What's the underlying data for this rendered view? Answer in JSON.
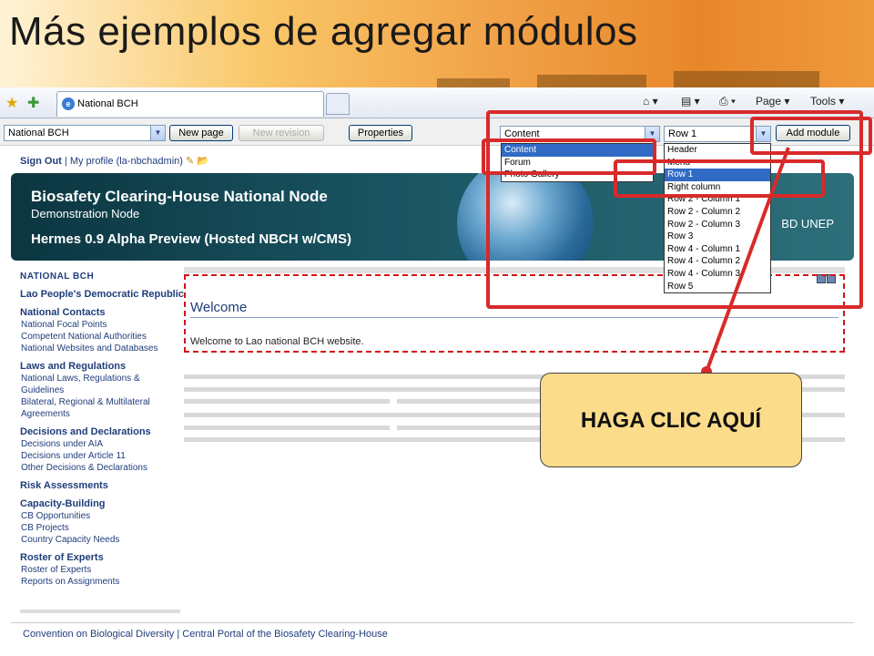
{
  "slide": {
    "title": "Más ejemplos de agregar módulos"
  },
  "browser": {
    "tab_title": "National BCH",
    "tab_icon_letter": "e",
    "page_menu": "Page ▾",
    "tools_menu": "Tools ▾"
  },
  "cms_toolbar": {
    "site_select": "National BCH",
    "new_page": "New page",
    "new_revision": "New revision",
    "properties": "Properties",
    "module_type_select": "Content",
    "position_select": "Row 1",
    "add_module": "Add module"
  },
  "module_type_options": [
    "Content",
    "Forum",
    "Photo Gallery"
  ],
  "module_type_selected_index": 0,
  "position_options": [
    "Header",
    "Menu",
    "Row 1",
    "Right column",
    "Row 2 - Column 1",
    "Row 2 - Column 2",
    "Row 2 - Column 3",
    "Row 3",
    "Row 4 - Column 1",
    "Row 4 - Column 2",
    "Row 4 - Column 3",
    "Row 5"
  ],
  "position_selected_index": 2,
  "profile": {
    "sign_out": "Sign Out",
    "separator": "|",
    "my_profile": "My profile",
    "username": "(la-nbchadmin)"
  },
  "banner": {
    "title": "Biosafety Clearing-House National Node",
    "subtitle": "Demonstration Node",
    "version": "Hermes 0.9 Alpha Preview (Hosted NBCH w/CMS)",
    "logos": "BD   UNEP"
  },
  "sidebar": {
    "sections": [
      {
        "title": "NATIONAL BCH",
        "links": []
      },
      {
        "title": "Lao People's Democratic Republic",
        "links": []
      },
      {
        "title": "National Contacts",
        "links": [
          "National Focal Points",
          "Competent National Authorities",
          "National Websites and Databases"
        ]
      },
      {
        "title": "Laws and Regulations",
        "links": [
          "National Laws, Regulations & Guidelines",
          "Bilateral, Regional & Multilateral Agreements"
        ]
      },
      {
        "title": "Decisions and Declarations",
        "links": [
          "Decisions under AIA",
          "Decisions under Article 11",
          "Other Decisions & Declarations"
        ]
      },
      {
        "title": "Risk Assessments",
        "links": []
      },
      {
        "title": "Capacity-Building",
        "links": [
          "CB Opportunities",
          "CB Projects",
          "Country Capacity Needs"
        ]
      },
      {
        "title": "Roster of Experts",
        "links": [
          "Roster of Experts",
          "Reports on Assignments"
        ]
      }
    ]
  },
  "main": {
    "welcome_title": "Welcome",
    "welcome_text": "Welcome to Lao national BCH website."
  },
  "footer": {
    "text": "Convention on Biological Diversity | Central Portal of the Biosafety Clearing-House"
  },
  "annotation": {
    "callout": "HAGA CLIC AQUÍ",
    "color": "#d82a2a",
    "callout_bg": "#fbdc8a"
  }
}
